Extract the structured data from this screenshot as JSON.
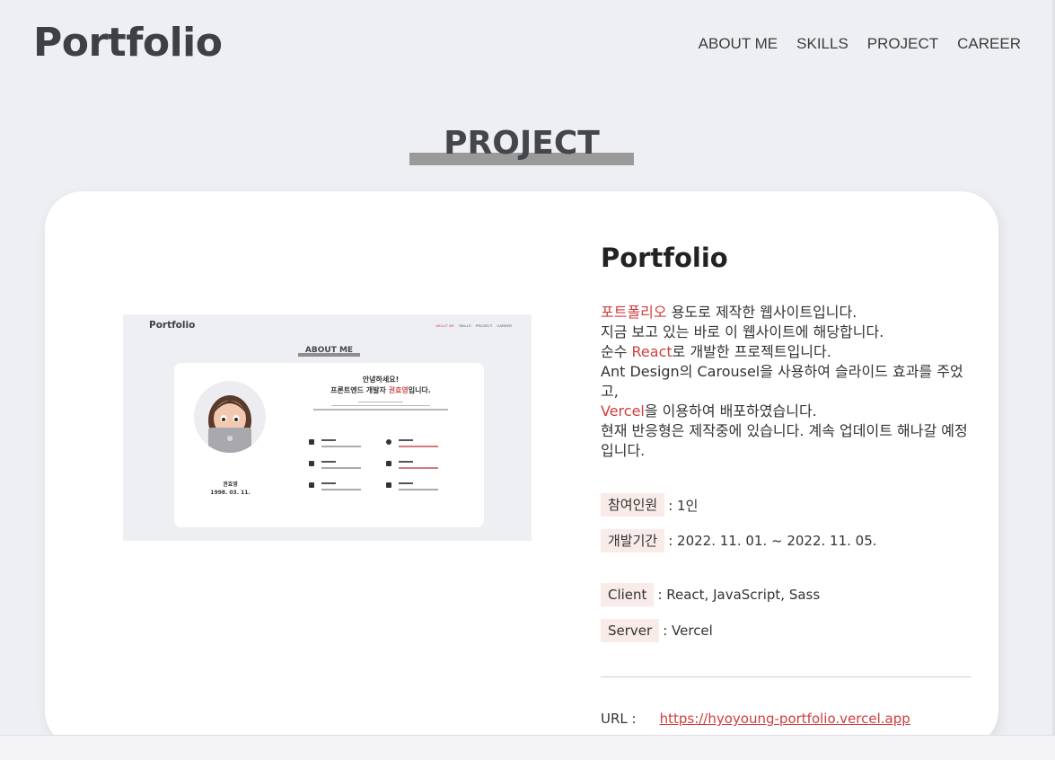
{
  "header": {
    "logo": "Portfolio",
    "nav": [
      "ABOUT ME",
      "SKILLS",
      "PROJECT",
      "CAREER"
    ]
  },
  "section": {
    "title": "PROJECT"
  },
  "preview": {
    "logo": "Portfolio",
    "nav": [
      "ABOUT ME",
      "SKILLS",
      "PROJECT",
      "CAREER"
    ],
    "title": "ABOUT ME",
    "hello_line1": "안녕하세요!",
    "hello_line2_pre": "프론트엔드 개발자 ",
    "hello_line2_name": "권효영",
    "hello_line2_post": "입니다.",
    "name": "권효영",
    "birth": "1998. 03. 11.",
    "dot_colors": [
      "#f6f53a",
      "#e3e3e8",
      "#e3e3e8"
    ]
  },
  "project": {
    "title": "Portfolio",
    "desc": {
      "l1_red": "포트폴리오",
      "l1_rest": " 용도로 제작한 웹사이트입니다.",
      "l2": "지금 보고 있는 바로 이 웹사이트에 해당합니다.",
      "l3_pre": "순수 ",
      "l3_red": "React",
      "l3_post": "로 개발한 프로젝트입니다.",
      "l4": "Ant Design의 Carousel을 사용하여 슬라이드 효과를 주었고,",
      "l5_red": "Vercel",
      "l5_rest": "을 이용하여 배포하였습니다.",
      "l6": "현재 반응형은 제작중에 있습니다. 계속 업데이트 해나갈 예정입니다."
    },
    "members": {
      "label": "참여인원",
      "value": ": 1인"
    },
    "period": {
      "label": "개발기간",
      "value": ": 2022. 11. 01. ~ 2022. 11. 05."
    },
    "client": {
      "label": "Client",
      "value": ": React, JavaScript, Sass"
    },
    "server": {
      "label": "Server",
      "value": ": Vercel"
    },
    "url": {
      "label": "URL :",
      "link": "https://hyoyoung-portfolio.vercel.app"
    }
  }
}
